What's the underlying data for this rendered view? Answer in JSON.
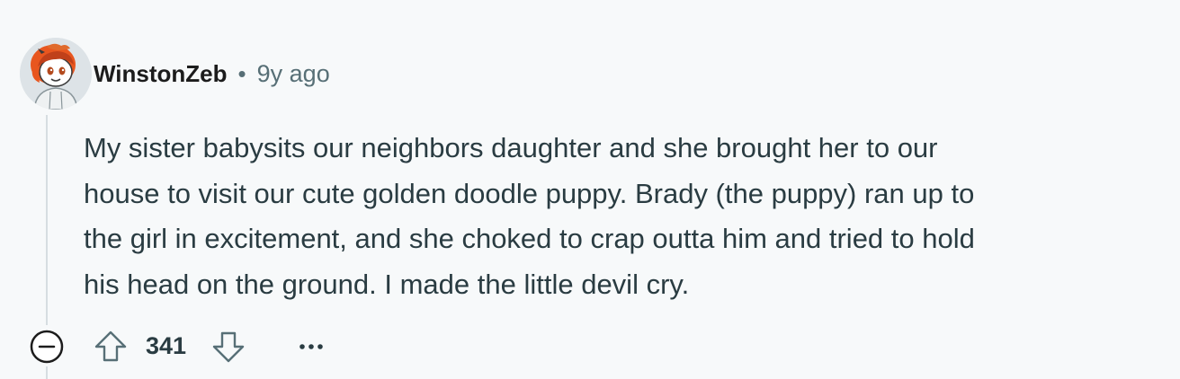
{
  "comment": {
    "author": "WinstonZeb",
    "separator": "•",
    "age": "9y ago",
    "body": [
      "My sister babysits our neighbors daughter and she brought her to our",
      "house to visit our cute golden doodle puppy. Brady (the puppy) ran up to",
      "the girl in excitement, and she choked to crap outta him and tried to hold",
      "his head on the ground. I made the little devil cry."
    ],
    "score": "341"
  },
  "icons": {
    "avatar": "snoo-avatar",
    "collapse": "minus-circle-icon",
    "upvote": "arrow-up-outline-icon",
    "downvote": "arrow-down-outline-icon",
    "overflow": "more-horizontal-icon"
  },
  "colors": {
    "background": "#f7f9fa",
    "text_primary": "#1c1c1c",
    "text_secondary": "#576f76",
    "thread_line": "#d6dde1",
    "avatar_accent": "#e8561f"
  }
}
